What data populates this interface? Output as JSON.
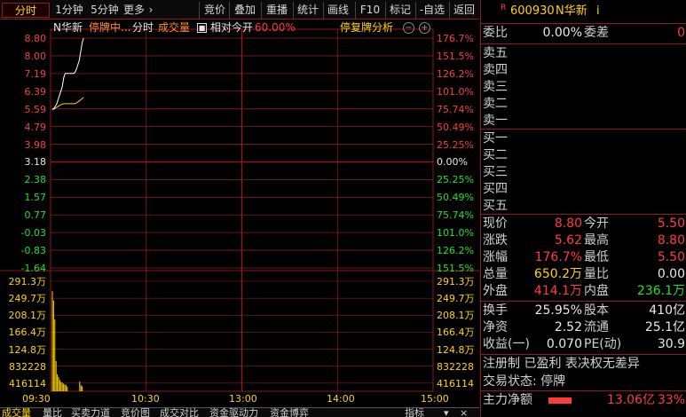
{
  "toolbar": {
    "tabs": [
      "分时",
      "1分钟",
      "5分钟",
      "更多"
    ],
    "more_arrow": "›",
    "buttons": [
      "竞价",
      "叠加",
      "重播",
      "统计",
      "画线",
      "F10",
      "标记",
      "-自选",
      "返回"
    ]
  },
  "chart_header": {
    "name": "N华新",
    "status": "停牌中...",
    "mode": "分时",
    "volume": "成交量",
    "relative": "相对今开",
    "relative_pct": "60.00%",
    "resume": "停复牌分析"
  },
  "colors": {
    "up": "#ff3c3c",
    "down": "#22e022",
    "flat": "#e8e8e8",
    "price_line": "#ffffff",
    "avg_line": "#ffd400",
    "grid": "#8a1c1c"
  },
  "chart_data": {
    "type": "line",
    "x_ticks": [
      "09:30",
      "10:30",
      "13:00",
      "14:00",
      "15:00"
    ],
    "price_ticks": [
      "8.80",
      "8.00",
      "7.19",
      "6.39",
      "5.59",
      "4.79",
      "3.98",
      "3.18",
      "2.38",
      "1.57",
      "0.77",
      "-0.03",
      "-0.83",
      "-1.64"
    ],
    "pct_ticks": [
      "176.7%",
      "151.5%",
      "126.2%",
      "101.0%",
      "75.74%",
      "50.49%",
      "25.25%",
      "0.00%",
      "25.25%",
      "50.49%",
      "75.74%",
      "101.0%",
      "126.2%",
      "151.5%"
    ],
    "vol_ticks_left": [
      "291.3万",
      "249.7万",
      "208.1万",
      "166.4万",
      "124.8万",
      "832228",
      "416114"
    ],
    "vol_ticks_right": [
      "291.3万",
      "249.7万",
      "208.1万",
      "166.4万",
      "124.8万",
      "832228",
      "416114"
    ],
    "prev_close": 3.18,
    "price_range": [
      -1.64,
      8.8
    ],
    "volume_max": 2913000,
    "price": [
      5.55,
      5.6,
      5.7,
      5.8,
      6.0,
      6.2,
      6.4,
      6.6,
      7.0,
      7.2,
      7.2,
      7.2,
      7.2,
      7.2,
      7.2,
      7.2,
      7.25,
      7.4,
      7.6,
      7.8,
      8.2,
      8.6,
      8.8
    ],
    "avg": [
      5.55,
      5.58,
      5.62,
      5.66,
      5.7,
      5.74,
      5.78,
      5.8,
      5.82,
      5.82,
      5.82,
      5.82,
      5.82,
      5.82,
      5.82,
      5.82,
      5.83,
      5.86,
      5.9,
      5.95,
      6.0,
      6.06,
      6.1
    ],
    "volume": [
      2650000,
      2400000,
      1900000,
      800000,
      450000,
      380000,
      300000,
      250000,
      230000,
      200000,
      180000,
      170000,
      120000,
      0,
      0,
      0,
      0,
      0,
      0,
      0,
      0,
      0,
      260000,
      160000,
      130000
    ]
  },
  "quote": {
    "code": "600930",
    "name": "N华新",
    "badge": "R",
    "info_icon": "i",
    "weibi_label": "委比",
    "weibi": "0.00%",
    "weicha_label": "委差",
    "weicha": "0",
    "sell": [
      "卖五",
      "卖四",
      "卖三",
      "卖二",
      "卖一"
    ],
    "buy": [
      "买一",
      "买二",
      "买三",
      "买四",
      "买五"
    ],
    "stats": [
      {
        "k1": "现价",
        "v1": "8.80",
        "c1": "red",
        "k2": "今开",
        "v2": "5.50",
        "c2": "red"
      },
      {
        "k1": "涨跌",
        "v1": "5.62",
        "c1": "red",
        "k2": "最高",
        "v2": "8.80",
        "c2": "red"
      },
      {
        "k1": "涨幅",
        "v1": "176.7%",
        "c1": "red",
        "k2": "最低",
        "v2": "5.50",
        "c2": "red"
      },
      {
        "k1": "总量",
        "v1": "650.2万",
        "c1": "yel",
        "k2": "量比",
        "v2": "0.00",
        "c2": "wht"
      },
      {
        "k1": "外盘",
        "v1": "414.1万",
        "c1": "red",
        "k2": "内盘",
        "v2": "236.1万",
        "c2": "grn"
      }
    ],
    "stats2": [
      {
        "k1": "换手",
        "v1": "25.95%",
        "k2": "股本",
        "v2": "410亿"
      },
      {
        "k1": "净资",
        "v1": "2.52",
        "k2": "流通",
        "v2": "25.1亿"
      },
      {
        "k1": "收益(一)",
        "v1": "0.070",
        "k2": "PE(动)",
        "v2": "30.9"
      }
    ],
    "note1": "注册制 已盈利 表决权无差异",
    "note2": "交易状态: 停牌",
    "flow_label": "主力净额",
    "flow_value": "13.06亿",
    "flow_pct": "33%"
  },
  "bottom_tabs": [
    "成交量",
    "量比",
    "买卖力道",
    "竞价图",
    "成交对比",
    "资金驱动力",
    "资金博弈",
    "指标"
  ]
}
